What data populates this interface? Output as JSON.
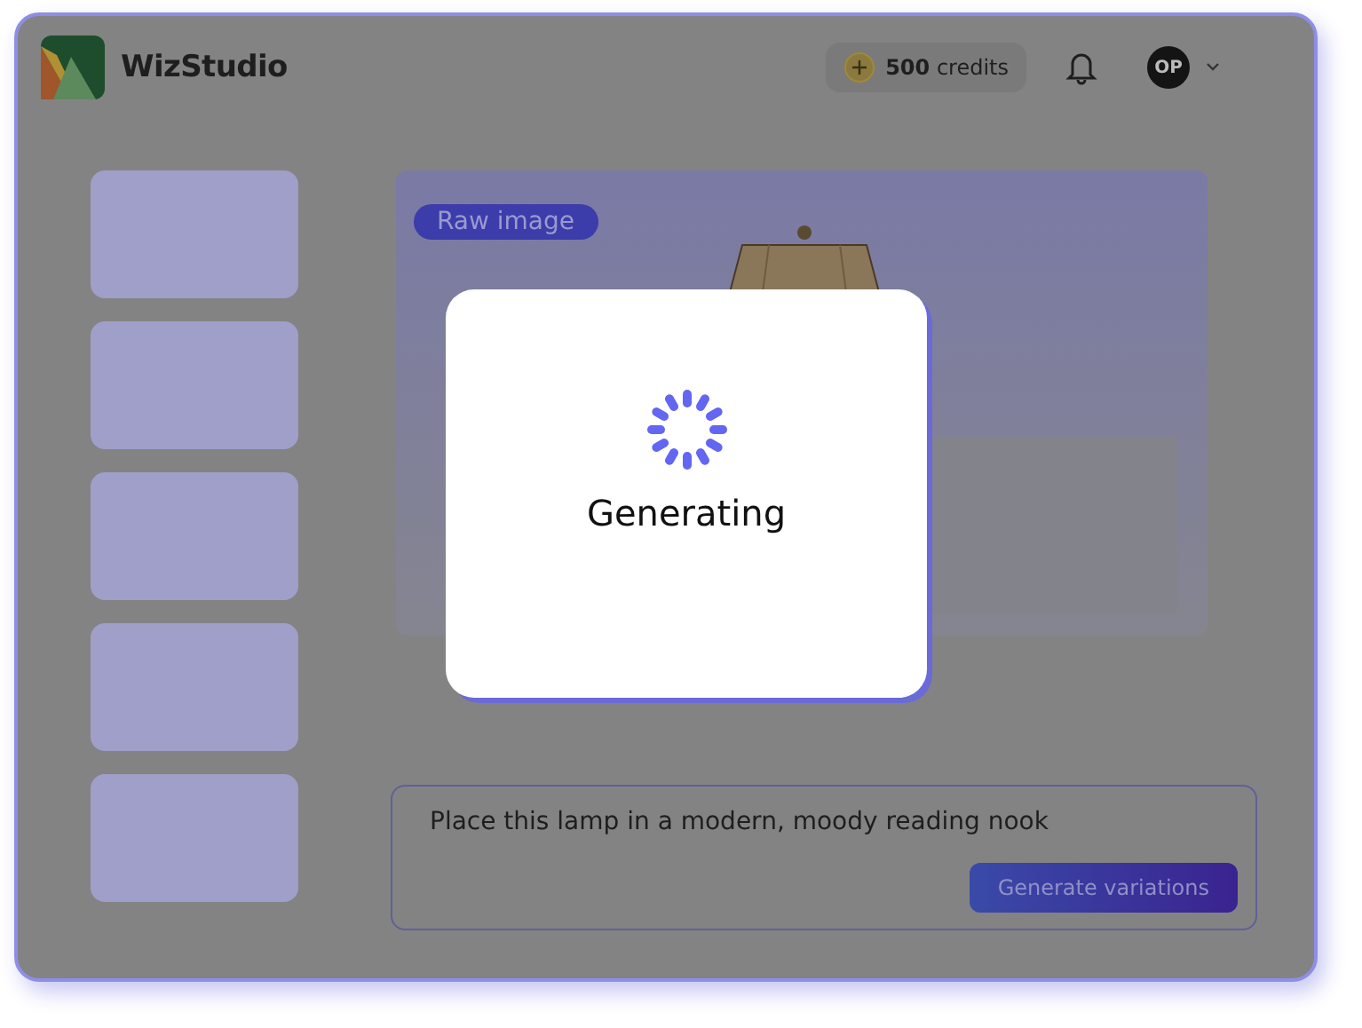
{
  "app": {
    "name": "WizStudio"
  },
  "header": {
    "credits": "**500** credits",
    "avatar": "OP"
  },
  "thumbnails": [
    {
      "kind": "placeholder"
    },
    {
      "kind": "placeholder"
    },
    {
      "kind": "placeholder"
    },
    {
      "kind": "placeholder"
    },
    {
      "kind": "placeholder"
    }
  ],
  "preview": {
    "badge": "Raw image",
    "kind": "picture"
  },
  "prompt": {
    "value": "Place this lamp in a modern, moody reading nook",
    "button": "Generate variations"
  },
  "modal": {
    "message": "Generating"
  }
}
